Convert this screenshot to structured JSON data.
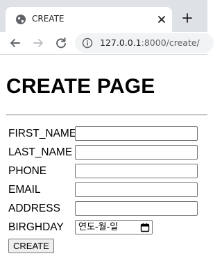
{
  "browser": {
    "tab": {
      "title": "CREATE",
      "favicon": "globe-icon",
      "close_icon": "close-icon"
    },
    "new_tab_icon": "plus-icon",
    "nav": {
      "back_icon": "arrow-left-icon",
      "forward_icon": "arrow-right-icon",
      "reload_icon": "reload-icon"
    },
    "address_bar": {
      "info_icon": "info-icon",
      "url_host": "127.0.0.1",
      "url_path": ":8000/create/"
    }
  },
  "page": {
    "title": "CREATE PAGE",
    "form": {
      "fields": [
        {
          "label": "FIRST_NAME",
          "type": "text",
          "value": ""
        },
        {
          "label": "LAST_NAME",
          "type": "text",
          "value": ""
        },
        {
          "label": "PHONE",
          "type": "text",
          "value": ""
        },
        {
          "label": "EMAIL",
          "type": "text",
          "value": ""
        },
        {
          "label": "ADDRESS",
          "type": "text",
          "value": ""
        },
        {
          "label": "BIRGHDAY",
          "type": "date",
          "placeholder": "연도-월-일"
        }
      ],
      "submit_label": "CREATE"
    }
  },
  "colors": {
    "tabstrip": "#dee1e6",
    "omnibox": "#f1f3f4",
    "input_border": "#767676",
    "button_bg": "#efefef"
  }
}
